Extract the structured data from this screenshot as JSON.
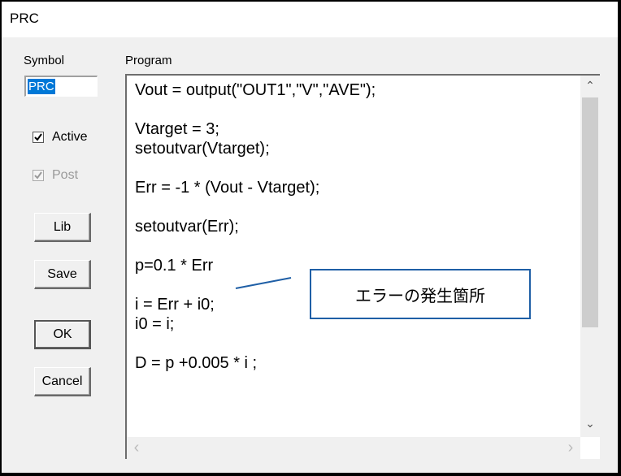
{
  "window": {
    "title": "PRC"
  },
  "symbol": {
    "label": "Symbol",
    "value": "PRC"
  },
  "program": {
    "label": "Program",
    "code": "Vout = output(\"OUT1\",\"V\",\"AVE\");\n\nVtarget = 3;\nsetoutvar(Vtarget);\n\nErr = -1 * (Vout - Vtarget);\n\nsetoutvar(Err);\n\np=0.1 * Err\n\ni = Err + i0;\ni0 = i;\n\nD = p +0.005 * i ;"
  },
  "options": {
    "active": {
      "label": "Active",
      "checked": true,
      "enabled": true
    },
    "post": {
      "label": "Post",
      "checked": true,
      "enabled": false
    }
  },
  "buttons": {
    "lib": "Lib",
    "save": "Save",
    "ok": "OK",
    "cancel": "Cancel"
  },
  "scrollbars": {
    "up": "⌃",
    "down": "⌄",
    "left": "‹",
    "right": "›"
  },
  "annotation": {
    "text": "エラーの発生箇所",
    "color": "#1f5fa6"
  }
}
